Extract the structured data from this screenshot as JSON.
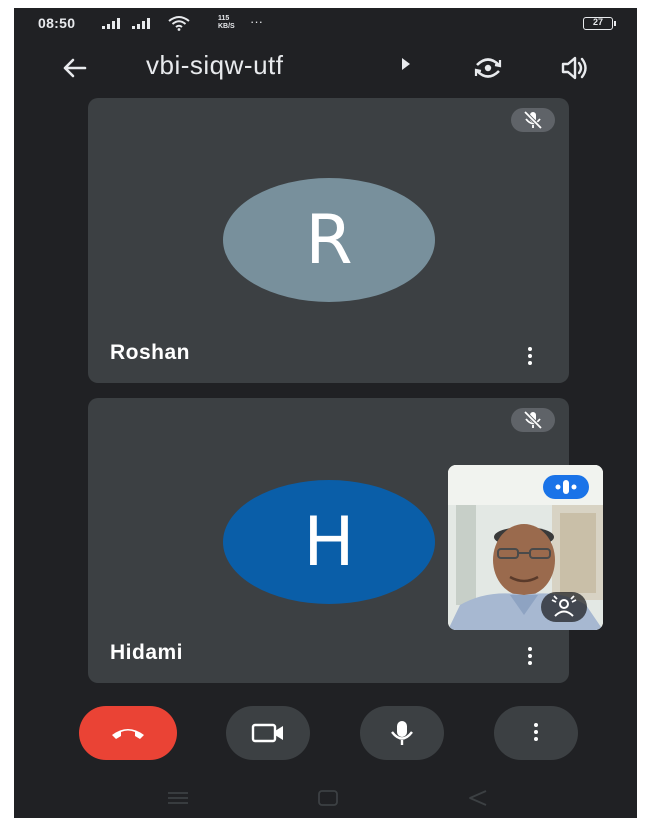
{
  "status_bar": {
    "time": "08:50",
    "net_speed_value": "115",
    "net_speed_unit": "KB/S",
    "more": "···",
    "battery": "27"
  },
  "header": {
    "meeting_code": "vbi-siqw-utf"
  },
  "participants": [
    {
      "initial": "R",
      "name": "Roshan",
      "avatar_color": "#78909c"
    },
    {
      "initial": "H",
      "name": "Hidami",
      "avatar_color": "#0a5ea8"
    }
  ],
  "colors": {
    "background": "#202124",
    "tile": "#3c4043",
    "end_call": "#ea4335",
    "accent": "#1a73e8"
  },
  "icons": {
    "back": "arrow-left-icon",
    "caret": "caret-right-icon",
    "switch_camera": "switch-camera-icon",
    "speaker": "speaker-icon",
    "mic_off": "mic-off-icon",
    "more": "more-vertical-icon",
    "end_call": "end-call-icon",
    "camera": "video-camera-icon",
    "mic": "mic-icon",
    "effects": "visual-effects-icon",
    "pip": "pip-icon"
  }
}
